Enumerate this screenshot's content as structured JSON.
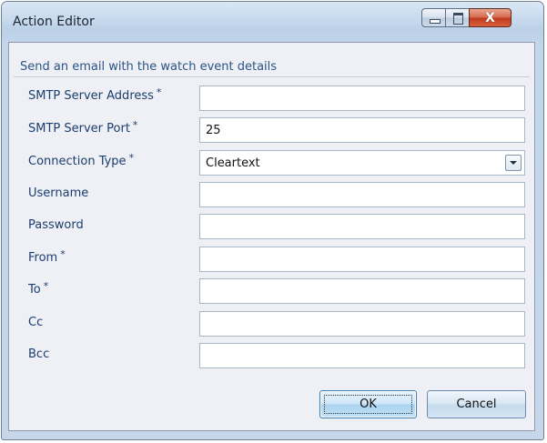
{
  "window": {
    "title": "Action Editor",
    "close_glyph": "X"
  },
  "description": "Send an email with the watch event details",
  "fields": [
    {
      "label": "SMTP Server Address",
      "required": "*",
      "value": "",
      "type": "text"
    },
    {
      "label": "SMTP Server Port",
      "required": "*",
      "value": "25",
      "type": "text"
    },
    {
      "label": "Connection Type",
      "required": "*",
      "value": "Cleartext",
      "type": "dropdown"
    },
    {
      "label": "Username",
      "required": "",
      "value": "",
      "type": "text"
    },
    {
      "label": "Password",
      "required": "",
      "value": "",
      "type": "password"
    },
    {
      "label": "From",
      "required": "*",
      "value": "",
      "type": "text"
    },
    {
      "label": "To",
      "required": "*",
      "value": "",
      "type": "text"
    },
    {
      "label": "Cc",
      "required": "",
      "value": "",
      "type": "text"
    },
    {
      "label": "Bcc",
      "required": "",
      "value": "",
      "type": "text"
    }
  ],
  "buttons": {
    "ok": "OK",
    "cancel": "Cancel"
  },
  "icons": {
    "minimize": "minimize-icon",
    "maximize": "maximize-icon",
    "close": "close-icon",
    "dropdown": "chevron-down-icon"
  },
  "colors": {
    "title_bar": "#c9dbee",
    "label_text": "#1b3e6e",
    "description_text": "#2a5485",
    "close_button": "#c0391c"
  }
}
